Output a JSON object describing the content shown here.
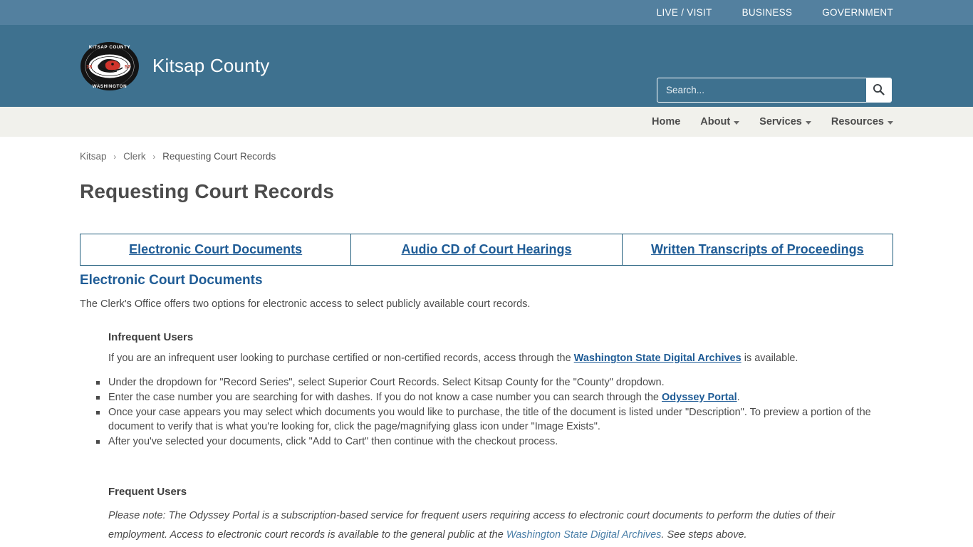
{
  "topbar": {
    "links": [
      {
        "label": "LIVE / VISIT"
      },
      {
        "label": "BUSINESS"
      },
      {
        "label": "GOVERNMENT"
      }
    ]
  },
  "header": {
    "site_name": "Kitsap County",
    "seal": {
      "top_text": "KITSAP COUNTY",
      "bottom_text": "WASHINGTON",
      "year_left": "18",
      "year_right": "57"
    },
    "search": {
      "placeholder": "Search...",
      "value": "",
      "button_icon": "search-icon"
    }
  },
  "nav": {
    "items": [
      {
        "label": "Home",
        "has_caret": false
      },
      {
        "label": "About",
        "has_caret": true
      },
      {
        "label": "Services",
        "has_caret": true
      },
      {
        "label": "Resources",
        "has_caret": true
      }
    ]
  },
  "breadcrumb": {
    "items": [
      {
        "label": "Kitsap"
      },
      {
        "label": "Clerk"
      },
      {
        "label": "Requesting Court Records"
      }
    ],
    "separator": "›"
  },
  "main": {
    "page_title": "Requesting Court Records",
    "tabs": [
      {
        "label": "Electronic Court Documents"
      },
      {
        "label": "Audio CD of Court Hearings"
      },
      {
        "label": "Written Transcripts of Proceedings"
      }
    ],
    "section_title": "Electronic Court Documents",
    "intro": "The Clerk's Office  offers two options for electronic access to select publicly available court records.",
    "infrequent": {
      "heading": "Infrequent Users",
      "lead_before": "If you are an infrequent user looking to purchase certified or non-certified records, access through the ",
      "lead_link": "Washington State Digital Archives",
      "lead_after": " is available.",
      "steps": [
        {
          "text": "Under the dropdown for \"Record Series\", select Superior Court Records. Select Kitsap County for the \"County\" dropdown."
        },
        {
          "before": "Enter the case number you are searching for with dashes. If you do not know a case number you  can search through  the ",
          "link": "Odyssey Portal",
          "after": "."
        },
        {
          "text": "Once your case appears you may select which documents you would like to purchase, the title of the document is listed under \"Description\". To preview a portion of the document to verify that is what you're looking for, click the page/magnifying glass icon under \"Image Exists\"."
        },
        {
          "text": "After you've selected your documents, click \"Add to Cart\" then continue with the checkout process."
        }
      ]
    },
    "frequent": {
      "heading": "Frequent Users",
      "note_before": "Please note:  The Odyssey Portal is a subscription-based service for frequent users requiring access to electronic court documents to perform the duties of their employment.  Access to electronic court records is available to the general public at the ",
      "note_link": "Washington State Digital Archives",
      "note_after": ". See steps above."
    }
  },
  "colors": {
    "topbar_bg": "#53809f",
    "header_bg": "#3e718f",
    "nav_bg": "#f1f1ec",
    "link_blue": "#1f5c96",
    "table_border": "#1f5c7c",
    "body_text": "#4a4a4a",
    "seal_red": "#c0392b"
  }
}
